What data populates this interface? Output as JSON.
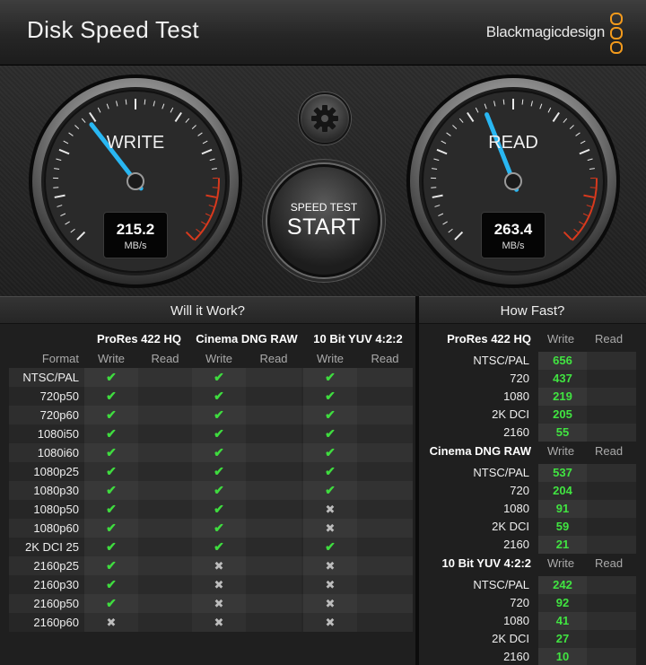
{
  "title": "Disk Speed Test",
  "brand": "Blackmagicdesign",
  "write_gauge": {
    "label": "WRITE",
    "value": "215.2",
    "unit": "MB/s",
    "level": 0.36
  },
  "read_gauge": {
    "label": "READ",
    "value": "263.4",
    "unit": "MB/s",
    "level": 0.42
  },
  "start_button": {
    "top": "SPEED TEST",
    "main": "START"
  },
  "will_it_work": {
    "header": "Will it Work?",
    "format_label": "Format",
    "write_label": "Write",
    "read_label": "Read",
    "codecs": [
      "ProRes 422 HQ",
      "Cinema DNG RAW",
      "10 Bit YUV 4:2:2"
    ],
    "rows": [
      {
        "format": "NTSC/PAL",
        "marks": [
          "ok",
          "ok",
          "ok"
        ]
      },
      {
        "format": "720p50",
        "marks": [
          "ok",
          "ok",
          "ok"
        ]
      },
      {
        "format": "720p60",
        "marks": [
          "ok",
          "ok",
          "ok"
        ]
      },
      {
        "format": "1080i50",
        "marks": [
          "ok",
          "ok",
          "ok"
        ]
      },
      {
        "format": "1080i60",
        "marks": [
          "ok",
          "ok",
          "ok"
        ]
      },
      {
        "format": "1080p25",
        "marks": [
          "ok",
          "ok",
          "ok"
        ]
      },
      {
        "format": "1080p30",
        "marks": [
          "ok",
          "ok",
          "ok"
        ]
      },
      {
        "format": "1080p50",
        "marks": [
          "ok",
          "ok",
          "no"
        ]
      },
      {
        "format": "1080p60",
        "marks": [
          "ok",
          "ok",
          "no"
        ]
      },
      {
        "format": "2K DCI 25",
        "marks": [
          "ok",
          "ok",
          "ok"
        ]
      },
      {
        "format": "2160p25",
        "marks": [
          "ok",
          "no",
          "no"
        ]
      },
      {
        "format": "2160p30",
        "marks": [
          "ok",
          "no",
          "no"
        ]
      },
      {
        "format": "2160p50",
        "marks": [
          "ok",
          "no",
          "no"
        ]
      },
      {
        "format": "2160p60",
        "marks": [
          "no",
          "no",
          "no"
        ]
      }
    ],
    "check_glyph": "✔",
    "cross_glyph": "✖"
  },
  "how_fast": {
    "header": "How Fast?",
    "write_label": "Write",
    "read_label": "Read",
    "groups": [
      {
        "codec": "ProRes 422 HQ",
        "rows": [
          {
            "format": "NTSC/PAL",
            "write": "656"
          },
          {
            "format": "720",
            "write": "437"
          },
          {
            "format": "1080",
            "write": "219"
          },
          {
            "format": "2K DCI",
            "write": "205"
          },
          {
            "format": "2160",
            "write": "55"
          }
        ]
      },
      {
        "codec": "Cinema DNG RAW",
        "rows": [
          {
            "format": "NTSC/PAL",
            "write": "537"
          },
          {
            "format": "720",
            "write": "204"
          },
          {
            "format": "1080",
            "write": "91"
          },
          {
            "format": "2K DCI",
            "write": "59"
          },
          {
            "format": "2160",
            "write": "21"
          }
        ]
      },
      {
        "codec": "10 Bit YUV 4:2:2",
        "rows": [
          {
            "format": "NTSC/PAL",
            "write": "242"
          },
          {
            "format": "720",
            "write": "92"
          },
          {
            "format": "1080",
            "write": "41"
          },
          {
            "format": "2K DCI",
            "write": "27"
          },
          {
            "format": "2160",
            "write": "10"
          }
        ]
      }
    ]
  },
  "colors": {
    "check": "#3fdc3f",
    "speed_value": "#41e441",
    "needle": "#29b7f2",
    "redline": "#d8391d"
  }
}
